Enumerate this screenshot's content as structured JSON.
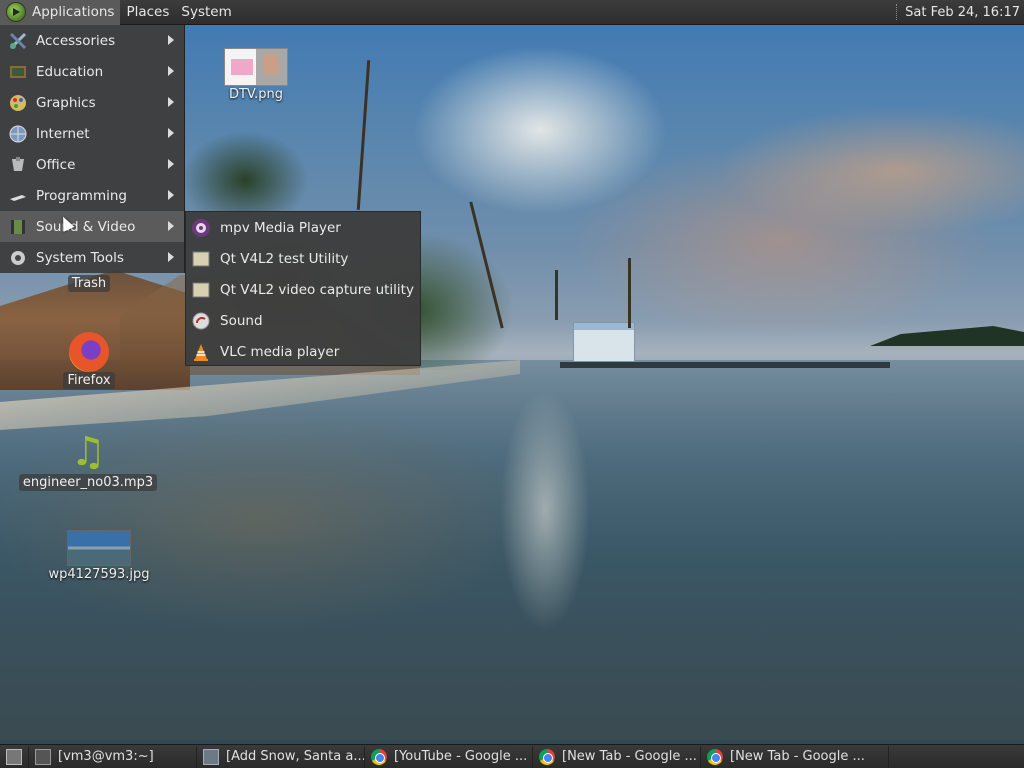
{
  "top_panel": {
    "applications": "Applications",
    "places": "Places",
    "system": "System",
    "clock": "Sat Feb 24, 16:17"
  },
  "app_menu": {
    "items": [
      {
        "label": "Accessories",
        "icon": "accessories-icon"
      },
      {
        "label": "Education",
        "icon": "education-icon"
      },
      {
        "label": "Graphics",
        "icon": "graphics-icon"
      },
      {
        "label": "Internet",
        "icon": "internet-icon"
      },
      {
        "label": "Office",
        "icon": "office-icon"
      },
      {
        "label": "Programming",
        "icon": "programming-icon"
      },
      {
        "label": "Sound & Video",
        "icon": "sound-video-icon"
      },
      {
        "label": "System Tools",
        "icon": "system-tools-icon"
      }
    ]
  },
  "sub_menu": {
    "items": [
      {
        "label": "mpv Media Player",
        "icon": "mpv-icon"
      },
      {
        "label": "Qt V4L2 test Utility",
        "icon": "qv4l2-icon"
      },
      {
        "label": "Qt V4L2 video capture utility",
        "icon": "qvidcap-icon"
      },
      {
        "label": "Sound",
        "icon": "sound-icon"
      },
      {
        "label": "VLC media player",
        "icon": "vlc-icon"
      }
    ]
  },
  "desktop": {
    "icons": [
      {
        "label": "DTV.png"
      },
      {
        "label": "Trash"
      },
      {
        "label": "Firefox"
      },
      {
        "label": "engineer_no03.mp3"
      },
      {
        "label": "wp4127593.jpg"
      }
    ]
  },
  "taskbar": {
    "tasks": [
      {
        "label": "[vm3@vm3:~]",
        "icon": "terminal-icon"
      },
      {
        "label": "[Add Snow, Santa a...",
        "icon": "window-icon"
      },
      {
        "label": "[YouTube - Google ...",
        "icon": "chrome-icon"
      },
      {
        "label": "[New Tab - Google ...",
        "icon": "chrome-icon"
      },
      {
        "label": "[New Tab - Google ...",
        "icon": "chrome-icon"
      }
    ]
  },
  "colors": {
    "panel": "#2d2d2d",
    "menu_bg": "#3e3e3e",
    "highlight": "#5b5b5b"
  }
}
